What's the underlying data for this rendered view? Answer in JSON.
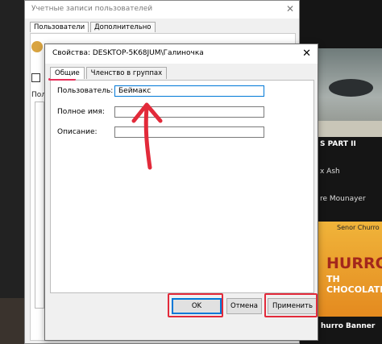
{
  "background": {
    "title_1": "S PART II",
    "title_2": "x Ash",
    "title_3": "re Mounayer",
    "banner_top": "Senor Churro",
    "banner_big": "HURROS",
    "banner_sub": "TH CHOCOLATE",
    "title_4": "hurro Banner"
  },
  "parent_window": {
    "title": "Учетные записи пользователей",
    "tabs": [
      "Пользователи",
      "Дополнительно"
    ],
    "list_label": "Пол"
  },
  "dialog": {
    "title": "Свойства: DESKTOP-5K68JUM\\Галиночка",
    "close_glyph": "✕",
    "tabs": [
      "Общие",
      "Членство в группах"
    ],
    "fields": {
      "username_label": "Пользователь:",
      "username_value": "Беймакс",
      "fullname_label": "Полное имя:",
      "fullname_value": "",
      "description_label": "Описание:",
      "description_value": ""
    },
    "buttons": {
      "ok": "OK",
      "cancel": "Отмена",
      "apply": "Применить"
    }
  },
  "annotations": {
    "color": "#e22a3a"
  }
}
